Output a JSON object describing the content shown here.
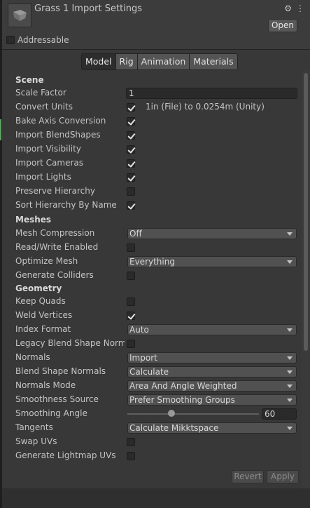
{
  "header": {
    "title": "Grass 1 Import Settings",
    "open_label": "Open",
    "icons": [
      "sliders-icon",
      "more-vert-icon"
    ]
  },
  "addressable": {
    "label": "Addressable",
    "checked": false
  },
  "tabs": [
    {
      "label": "Model",
      "active": true
    },
    {
      "label": "Rig",
      "active": false
    },
    {
      "label": "Animation",
      "active": false
    },
    {
      "label": "Materials",
      "active": false
    }
  ],
  "scene": {
    "heading": "Scene",
    "scale_factor": {
      "label": "Scale Factor",
      "value": "1"
    },
    "convert_units": {
      "label": "Convert Units",
      "checked": true,
      "note": "1in (File) to 0.0254m (Unity)"
    },
    "bake_axis": {
      "label": "Bake Axis Conversion",
      "checked": true
    },
    "blendshapes": {
      "label": "Import BlendShapes",
      "checked": true
    },
    "visibility": {
      "label": "Import Visibility",
      "checked": true
    },
    "cameras": {
      "label": "Import Cameras",
      "checked": true
    },
    "lights": {
      "label": "Import Lights",
      "checked": true
    },
    "preserve_hierarchy": {
      "label": "Preserve Hierarchy",
      "checked": false
    },
    "sort_hierarchy": {
      "label": "Sort Hierarchy By Name",
      "checked": true
    }
  },
  "meshes": {
    "heading": "Meshes",
    "compression": {
      "label": "Mesh Compression",
      "value": "Off"
    },
    "read_write": {
      "label": "Read/Write Enabled",
      "checked": false
    },
    "optimize": {
      "label": "Optimize Mesh",
      "value": "Everything"
    },
    "colliders": {
      "label": "Generate Colliders",
      "checked": false
    }
  },
  "geometry": {
    "heading": "Geometry",
    "keep_quads": {
      "label": "Keep Quads",
      "checked": false
    },
    "weld": {
      "label": "Weld Vertices",
      "checked": true
    },
    "index_format": {
      "label": "Index Format",
      "value": "Auto"
    },
    "legacy_blend": {
      "label": "Legacy Blend Shape Normals",
      "checked": false
    },
    "normals": {
      "label": "Normals",
      "value": "Import"
    },
    "blend_normals": {
      "label": "Blend Shape Normals",
      "value": "Calculate"
    },
    "normals_mode": {
      "label": "Normals Mode",
      "value": "Area And Angle Weighted"
    },
    "smoothness": {
      "label": "Smoothness Source",
      "value": "Prefer Smoothing Groups"
    },
    "smoothing_angle": {
      "label": "Smoothing Angle",
      "value": "60",
      "fraction": 0.333
    },
    "tangents": {
      "label": "Tangents",
      "value": "Calculate Mikktspace"
    },
    "swap_uvs": {
      "label": "Swap UVs",
      "checked": false
    },
    "lightmap_uvs": {
      "label": "Generate Lightmap UVs",
      "checked": false
    }
  },
  "footer": {
    "revert_label": "Revert",
    "apply_label": "Apply"
  }
}
